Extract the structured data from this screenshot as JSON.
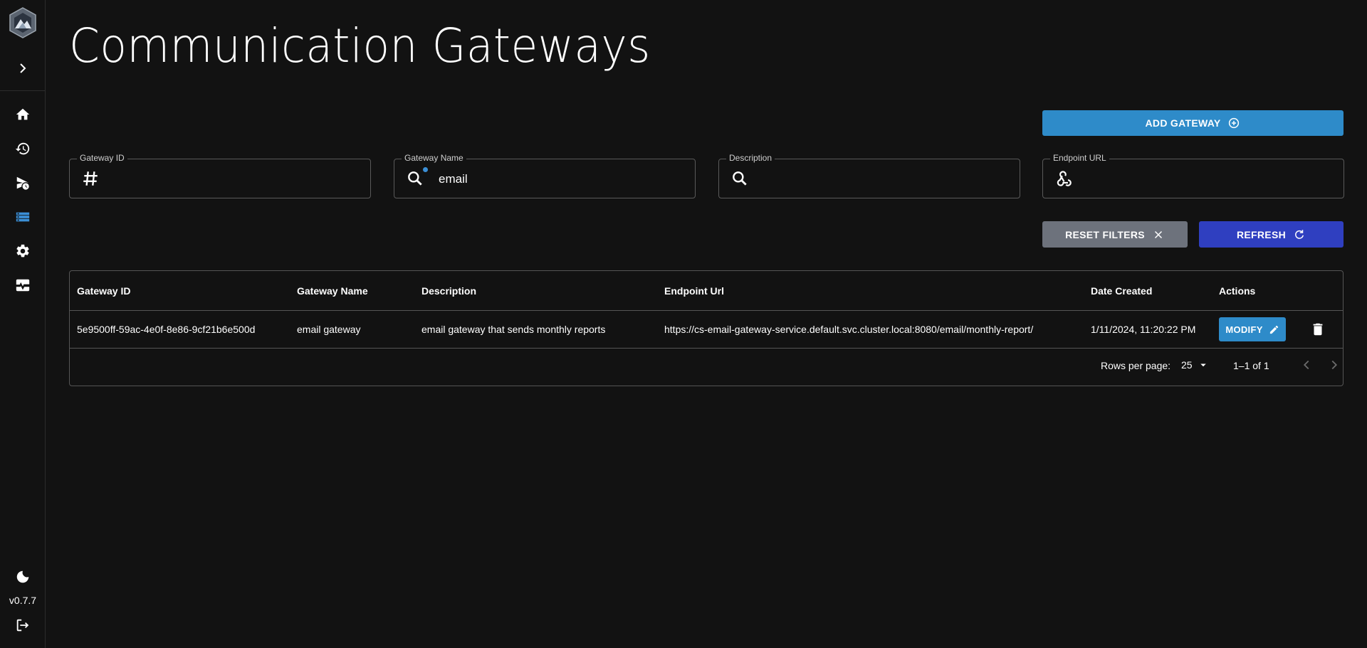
{
  "page": {
    "title": "Communication Gateways"
  },
  "sidebar": {
    "version": "v0.7.7",
    "items": [
      {
        "name": "home-icon"
      },
      {
        "name": "history-icon"
      },
      {
        "name": "scheduled-send-icon"
      },
      {
        "name": "gateways-list-icon",
        "active": true
      },
      {
        "name": "settings-icon"
      },
      {
        "name": "monitor-heart-icon"
      }
    ]
  },
  "toolbar": {
    "add_label": "ADD GATEWAY",
    "reset_label": "RESET FILTERS",
    "refresh_label": "REFRESH"
  },
  "filters": {
    "gateway_id": {
      "label": "Gateway ID",
      "value": ""
    },
    "gateway_name": {
      "label": "Gateway Name",
      "value": "email"
    },
    "description": {
      "label": "Description",
      "value": ""
    },
    "endpoint_url": {
      "label": "Endpoint URL",
      "value": ""
    }
  },
  "table": {
    "headers": [
      "Gateway ID",
      "Gateway Name",
      "Description",
      "Endpoint Url",
      "Date Created",
      "Actions"
    ],
    "rows": [
      {
        "gateway_id": "5e9500ff-59ac-4e0f-8e86-9cf21b6e500d",
        "gateway_name": "email gateway",
        "description": "email gateway that sends monthly reports",
        "endpoint_url": "https://cs-email-gateway-service.default.svc.cluster.local:8080/email/monthly-report/",
        "date_created": "1/11/2024, 11:20:22 PM",
        "modify_label": "MODIFY"
      }
    ],
    "rows_per_page_label": "Rows per page:",
    "rows_per_page_value": "25",
    "range": "1–1 of 1"
  },
  "colors": {
    "background": "#121212",
    "accent": "#2e8bc9",
    "refresh": "#2f3fc0",
    "reset": "#6d727c"
  }
}
